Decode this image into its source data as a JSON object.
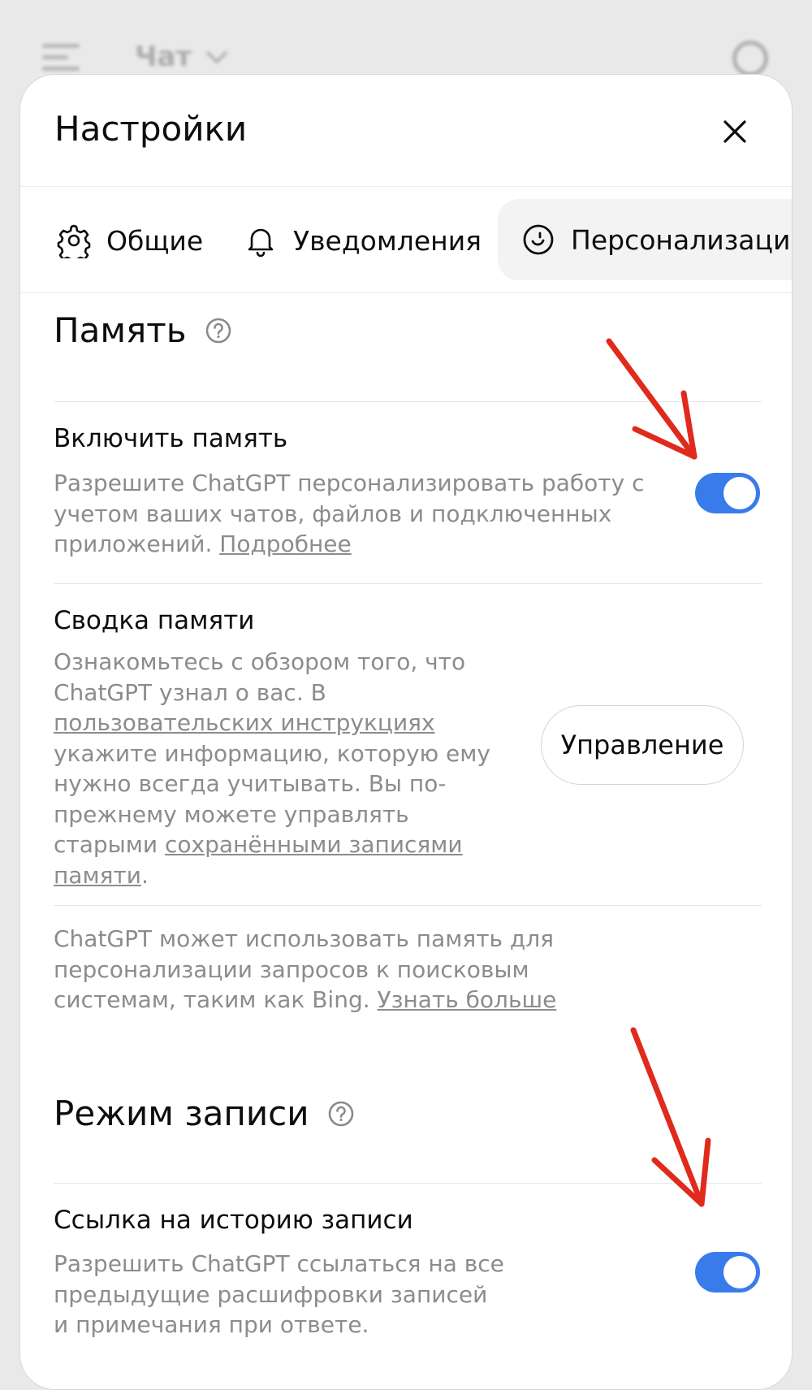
{
  "background": {
    "app_title": "Чат"
  },
  "modal": {
    "title": "Настройки"
  },
  "tabs": [
    {
      "label": "Общие",
      "icon": "gear-icon"
    },
    {
      "label": "Уведомления",
      "icon": "bell-icon"
    },
    {
      "label": "Персонализаци",
      "icon": "smile-icon",
      "active": true
    }
  ],
  "memory": {
    "section_title": "Память",
    "enable": {
      "title": "Включить память",
      "description": "Разрешите ChatGPT персонализировать работу с учетом ваших чатов, файлов и подключенных приложений.",
      "link": "Подробнее",
      "enabled": true
    },
    "summary": {
      "title": "Сводка памяти",
      "desc_1": "Ознакомьтесь с обзором того, что ChatGPT узнал о вас. В",
      "link_1": "пользовательских инструкциях",
      "desc_2": "укажите информацию, которую ему нужно всегда учитывать. Вы по-прежнему можете управлять старыми",
      "link_2": "сохранёнными записями памяти",
      "desc_end": ".",
      "button": "Управление"
    },
    "search_note": {
      "text": "ChatGPT может использовать память для персонализации запросов к поисковым системам, таким как Bing.",
      "link": "Узнать больше"
    }
  },
  "record_mode": {
    "section_title": "Режим записи",
    "history": {
      "title": "Ссылка на историю записи",
      "description": "Разрешить ChatGPT ссылаться на все предыдущие расшифровки записей и примечания при ответе.",
      "enabled": true
    }
  },
  "colors": {
    "toggle_on": "#3a7bec",
    "annotation_arrow": "#e02a1c"
  }
}
